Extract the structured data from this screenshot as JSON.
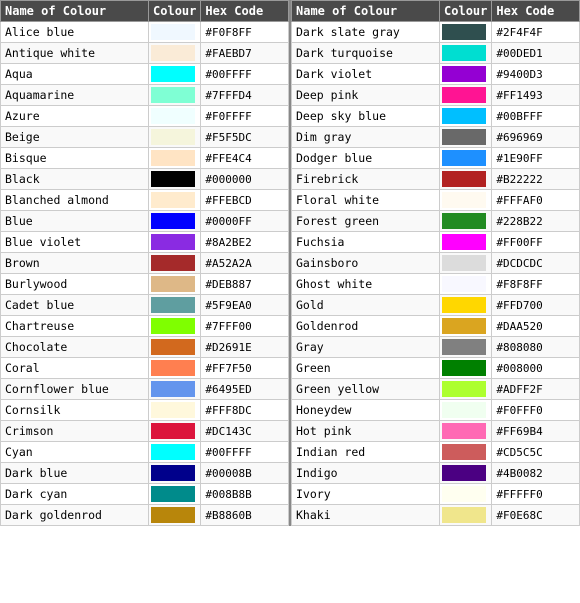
{
  "left_headers": [
    "Name of Colour",
    "Colour",
    "Hex Code"
  ],
  "right_headers": [
    "Name of Colour",
    "Colour",
    "Hex Code"
  ],
  "left_rows": [
    [
      "Alice blue",
      "#F0F8FF"
    ],
    [
      "Antique white",
      "#FAEBD7"
    ],
    [
      "Aqua",
      "#00FFFF"
    ],
    [
      "Aquamarine",
      "#7FFFD4"
    ],
    [
      "Azure",
      "#F0FFFF"
    ],
    [
      "Beige",
      "#F5F5DC"
    ],
    [
      "Bisque",
      "#FFE4C4"
    ],
    [
      "Black",
      "#000000"
    ],
    [
      "Blanched almond",
      "#FFEBCD"
    ],
    [
      "Blue",
      "#0000FF"
    ],
    [
      "Blue violet",
      "#8A2BE2"
    ],
    [
      "Brown",
      "#A52A2A"
    ],
    [
      "Burlywood",
      "#DEB887"
    ],
    [
      "Cadet blue",
      "#5F9EA0"
    ],
    [
      "Chartreuse",
      "#7FFF00"
    ],
    [
      "Chocolate",
      "#D2691E"
    ],
    [
      "Coral",
      "#FF7F50"
    ],
    [
      "Cornflower blue",
      "#6495ED"
    ],
    [
      "Cornsilk",
      "#FFF8DC"
    ],
    [
      "Crimson",
      "#DC143C"
    ],
    [
      "Cyan",
      "#00FFFF"
    ],
    [
      "Dark blue",
      "#00008B"
    ],
    [
      "Dark cyan",
      "#008B8B"
    ],
    [
      "Dark goldenrod",
      "#B8860B"
    ]
  ],
  "right_rows": [
    [
      "Dark slate gray",
      "#2F4F4F"
    ],
    [
      "Dark turquoise",
      "#00DED1"
    ],
    [
      "Dark violet",
      "#9400D3"
    ],
    [
      "Deep pink",
      "#FF1493"
    ],
    [
      "Deep sky blue",
      "#00BFFF"
    ],
    [
      "Dim gray",
      "#696969"
    ],
    [
      "Dodger blue",
      "#1E90FF"
    ],
    [
      "Firebrick",
      "#B22222"
    ],
    [
      "Floral white",
      "#FFFAF0"
    ],
    [
      "Forest green",
      "#228B22"
    ],
    [
      "Fuchsia",
      "#FF00FF"
    ],
    [
      "Gainsboro",
      "#DCDCDC"
    ],
    [
      "Ghost white",
      "#F8F8FF"
    ],
    [
      "Gold",
      "#FFD700"
    ],
    [
      "Goldenrod",
      "#DAA520"
    ],
    [
      "Gray",
      "#808080"
    ],
    [
      "Green",
      "#008000"
    ],
    [
      "Green yellow",
      "#ADFF2F"
    ],
    [
      "Honeydew",
      "#F0FFF0"
    ],
    [
      "Hot pink",
      "#FF69B4"
    ],
    [
      "Indian red",
      "#CD5C5C"
    ],
    [
      "Indigo",
      "#4B0082"
    ],
    [
      "Ivory",
      "#FFFFF0"
    ],
    [
      "Khaki",
      "#F0E68C"
    ]
  ]
}
